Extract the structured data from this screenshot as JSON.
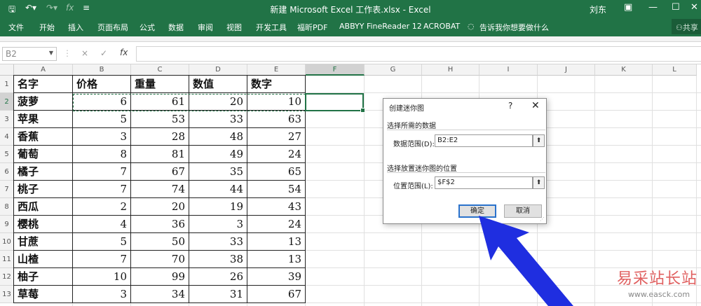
{
  "window": {
    "title": "新建 Microsoft Excel 工作表.xlsx  -  Excel",
    "user": "刘东",
    "qat_icons": [
      "save-icon",
      "undo-icon",
      "redo-icon",
      "function-icon",
      "customize-icon"
    ],
    "window_buttons": [
      "ribbon-display-icon",
      "minimize-icon",
      "maximize-icon",
      "close-icon"
    ]
  },
  "ribbon": {
    "tabs": [
      "文件",
      "开始",
      "插入",
      "页面布局",
      "公式",
      "数据",
      "审阅",
      "视图",
      "开发工具",
      "福昕PDF",
      "ABBYY FineReader 12",
      "ACROBAT"
    ],
    "tell_me": "告诉我你想要做什么",
    "share": "共享"
  },
  "formula_bar": {
    "name_box": "B2",
    "fx": "fx",
    "cancel": "×",
    "enter": "✓",
    "value": ""
  },
  "sheet": {
    "columns": [
      "A",
      "B",
      "C",
      "D",
      "E",
      "F",
      "G",
      "H",
      "I",
      "J",
      "K",
      "L"
    ],
    "rows": [
      "1",
      "2",
      "3",
      "4",
      "5",
      "6",
      "7",
      "8",
      "9",
      "10",
      "11",
      "12",
      "13"
    ],
    "header": [
      "名字",
      "价格",
      "重量",
      "数值",
      "数字"
    ],
    "data": [
      [
        "菠萝",
        "6",
        "61",
        "20",
        "10"
      ],
      [
        "苹果",
        "5",
        "53",
        "33",
        "63"
      ],
      [
        "香蕉",
        "3",
        "28",
        "48",
        "27"
      ],
      [
        "葡萄",
        "8",
        "81",
        "49",
        "24"
      ],
      [
        "橘子",
        "7",
        "67",
        "35",
        "65"
      ],
      [
        "桃子",
        "7",
        "74",
        "44",
        "54"
      ],
      [
        "西瓜",
        "2",
        "20",
        "19",
        "43"
      ],
      [
        "樱桃",
        "4",
        "36",
        "3",
        "24"
      ],
      [
        "甘蔗",
        "5",
        "50",
        "33",
        "13"
      ],
      [
        "山楂",
        "7",
        "70",
        "38",
        "13"
      ],
      [
        "柚子",
        "10",
        "99",
        "26",
        "39"
      ],
      [
        "草莓",
        "3",
        "34",
        "31",
        "67"
      ]
    ]
  },
  "dialog": {
    "title": "创建迷你图",
    "help": "?",
    "close": "✕",
    "section_data": "选择所需的数据",
    "data_range_label": "数据范围(D):",
    "data_range_value": "B2:E2",
    "section_location": "选择放置迷你图的位置",
    "location_label": "位置范围(L):",
    "location_value": "$F$2",
    "ok": "确定",
    "cancel": "取消"
  },
  "watermark": {
    "text": "易采站长站",
    "url": "www.easck.com"
  },
  "colors": {
    "excel_green": "#217346",
    "arrow_blue": "#1f2ee0"
  }
}
